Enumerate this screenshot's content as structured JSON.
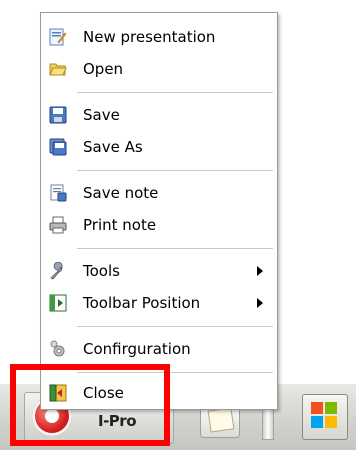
{
  "menu": {
    "items": [
      {
        "label": "New presentation",
        "icon": "new-presentation-icon"
      },
      {
        "label": "Open",
        "icon": "open-folder-icon"
      },
      {
        "label": "Save",
        "icon": "save-disk-icon"
      },
      {
        "label": "Save As",
        "icon": "save-as-icon"
      },
      {
        "label": "Save note",
        "icon": "save-note-icon"
      },
      {
        "label": "Print note",
        "icon": "printer-icon"
      },
      {
        "label": "Tools",
        "icon": "wrench-icon"
      },
      {
        "label": "Toolbar Position",
        "icon": "toolbar-position-icon"
      },
      {
        "label": "Confirguration",
        "icon": "gear-icon"
      },
      {
        "label": "Close",
        "icon": "exit-icon"
      }
    ]
  },
  "taskbar": {
    "app_name": "I-Pro"
  },
  "colors": {
    "highlight": "#ff0000",
    "menu_border": "#9a9a9a",
    "separator": "#c8c8c8"
  }
}
